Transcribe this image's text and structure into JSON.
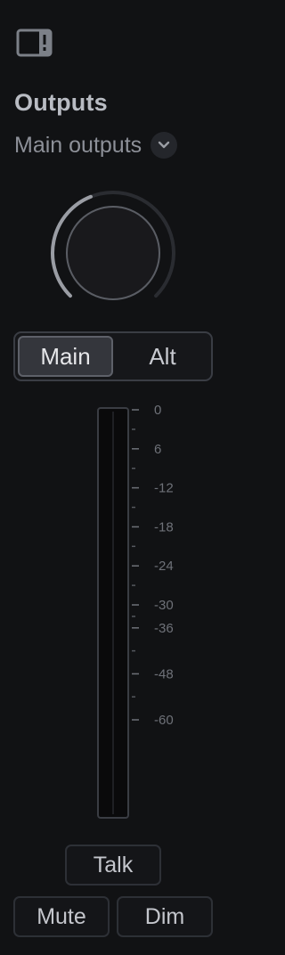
{
  "header": {
    "panel_toggle_icon": "sidebar-panel-icon"
  },
  "section": {
    "title": "Outputs",
    "output_select": {
      "value": "Main outputs",
      "icon": "chevron-down-icon"
    }
  },
  "volume_knob": {
    "level": 0.42,
    "track_color": "#2a2c31",
    "arc_color": "#9a9da4"
  },
  "monitor_toggle": {
    "options": [
      "Main",
      "Alt"
    ],
    "selected": "Main"
  },
  "meter": {
    "scale": [
      {
        "db": 0,
        "label": "0"
      },
      {
        "db": 6,
        "label": "6"
      },
      {
        "db": 12,
        "label": "-12"
      },
      {
        "db": 18,
        "label": "-18"
      },
      {
        "db": 24,
        "label": "-24"
      },
      {
        "db": 30,
        "label": "-30"
      },
      {
        "db": 36,
        "label": "-36"
      },
      {
        "db": 48,
        "label": "-48"
      },
      {
        "db": 60,
        "label": "-60"
      }
    ],
    "level": 0
  },
  "buttons": {
    "talk": "Talk",
    "mute": "Mute",
    "dim": "Dim"
  },
  "colors": {
    "background": "#111214",
    "text_muted": "#8d9098",
    "text_bright": "#e6e7ea",
    "border": "#3a3d44"
  }
}
